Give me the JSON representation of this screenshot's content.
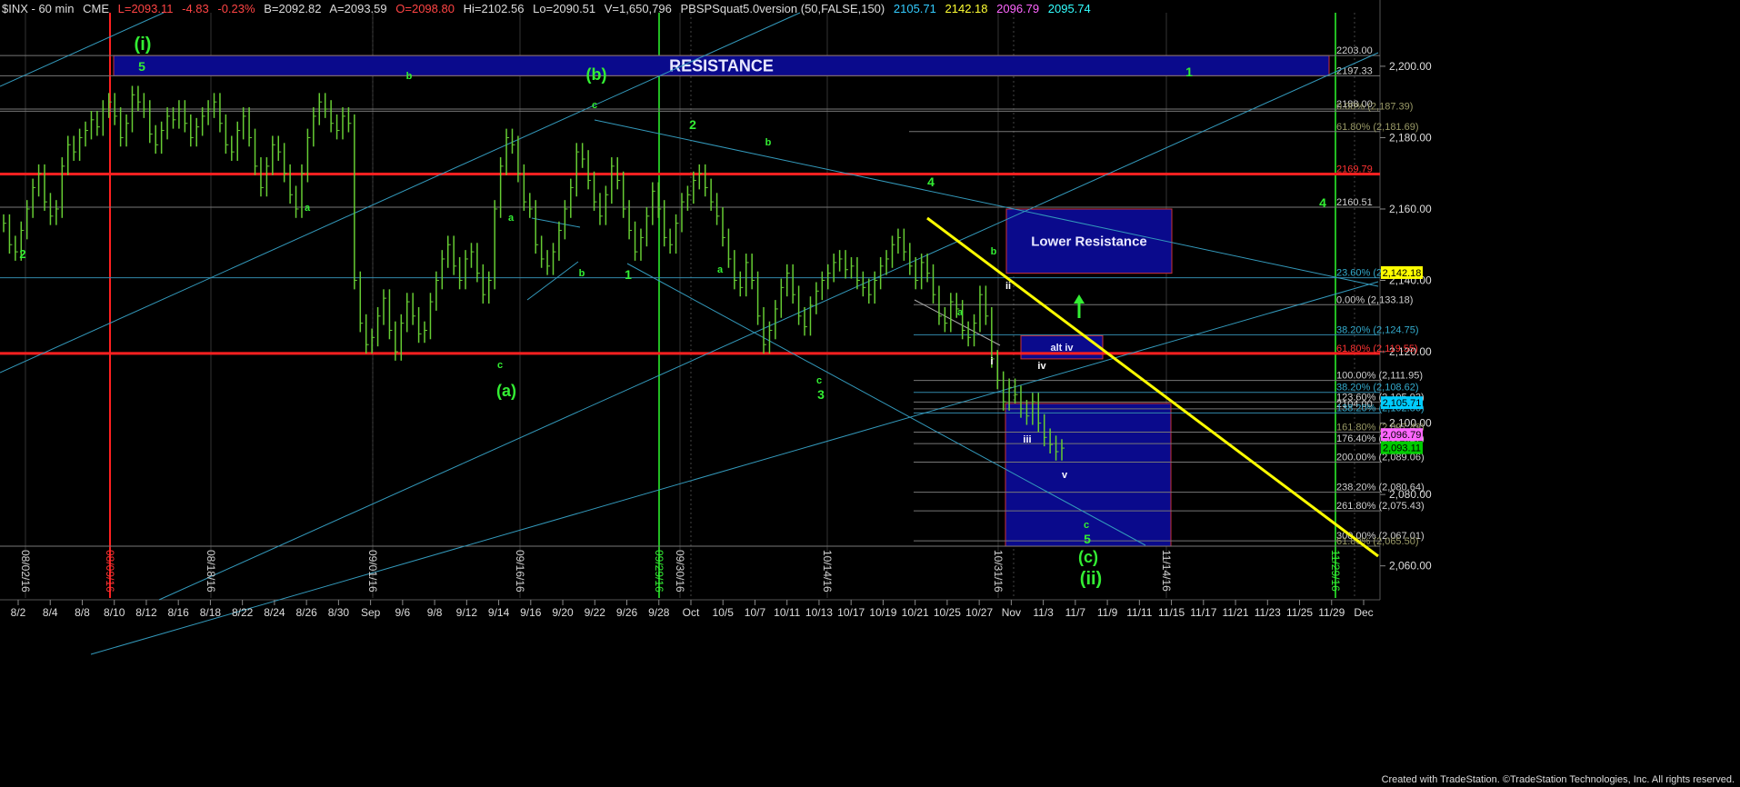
{
  "header": {
    "symbol": "$INX - 60 min",
    "exchange": "CME",
    "last": "L=2093.11",
    "change": "-4.83",
    "change_pct": "-0.23%",
    "bid": "B=2092.82",
    "ask": "A=2093.59",
    "open": "O=2098.80",
    "high": "Hi=2102.56",
    "low": "Lo=2090.51",
    "volume": "V=1,650,796",
    "study": "PBSPSquat5.0version (50,FALSE,150)",
    "study_values": [
      "2105.71",
      "2142.18",
      "2096.79",
      "2095.74"
    ],
    "study_colors": [
      "#33ccff",
      "#ffff33",
      "#ff66ff",
      "#33ffff"
    ]
  },
  "footer": "Created with TradeStation. ©TradeStation Technologies, Inc. All rights reserved.",
  "colors": {
    "background": "#000000",
    "bars": "#66cc33",
    "resistance_box": "#0a0a8c",
    "red_line": "#ff2020",
    "cyan_line": "#33aacc",
    "yellow_line": "#ffff00",
    "wave_label": "#33ee33",
    "fib_label": "#d0d0d0"
  },
  "chart_data": {
    "type": "line",
    "title": "",
    "xlabel": "",
    "ylabel": "",
    "ylim": [
      2051,
      2215
    ],
    "y_ticks": [
      "2,060.00",
      "2,080.00",
      "2,100.00",
      "2,120.00",
      "2,140.00",
      "2,160.00",
      "2,180.00",
      "2,200.00"
    ],
    "x_tick_labels": [
      "8/2",
      "8/4",
      "8/8",
      "8/10",
      "8/12",
      "8/16",
      "8/18",
      "8/22",
      "8/24",
      "8/26",
      "8/30",
      "Sep",
      "9/6",
      "9/8",
      "9/12",
      "9/14",
      "9/16",
      "9/20",
      "9/22",
      "9/26",
      "9/28",
      "Oct",
      "10/5",
      "10/7",
      "10/11",
      "10/13",
      "10/17",
      "10/19",
      "10/21",
      "10/25",
      "10/27",
      "Nov",
      "11/3",
      "11/7",
      "11/9",
      "11/11",
      "11/15",
      "11/17",
      "11/21",
      "11/23",
      "11/25",
      "11/29",
      "Dec"
    ],
    "vertical_date_labels": [
      {
        "text": "08/02/16",
        "color": "#d0d0d0"
      },
      {
        "text": "08/09/16",
        "color": "#ff3333"
      },
      {
        "text": "08/18/16",
        "color": "#d0d0d0"
      },
      {
        "text": "09/01/16",
        "color": "#d0d0d0"
      },
      {
        "text": "09/16/16",
        "color": "#d0d0d0"
      },
      {
        "text": "09/29/16",
        "color": "#33ee33"
      },
      {
        "text": "09/30/16",
        "color": "#d0d0d0"
      },
      {
        "text": "10/14/16",
        "color": "#d0d0d0"
      },
      {
        "text": "10/31/16",
        "color": "#d0d0d0"
      },
      {
        "text": "11/14/16",
        "color": "#d0d0d0"
      },
      {
        "text": "11/29/16",
        "color": "#33ee33"
      }
    ],
    "series": [
      {
        "values": [
          2156,
          2150,
          2148,
          2154,
          2160,
          2166,
          2170,
          2162,
          2158,
          2160,
          2172,
          2178,
          2176,
          2180,
          2182,
          2185,
          2183,
          2188,
          2190,
          2186,
          2180,
          2184,
          2192,
          2190,
          2188,
          2181,
          2178,
          2182,
          2186,
          2185,
          2188,
          2184,
          2180,
          2183,
          2186,
          2188,
          2190,
          2184,
          2178,
          2176,
          2182,
          2186,
          2180,
          2172,
          2166,
          2172,
          2178,
          2176,
          2170,
          2164,
          2160,
          2170,
          2180,
          2186,
          2190,
          2188,
          2184,
          2182,
          2186,
          2184,
          2140,
          2128,
          2122,
          2124,
          2130,
          2135,
          2126,
          2120,
          2128,
          2134,
          2130,
          2125,
          2126,
          2134,
          2140,
          2146,
          2150,
          2144,
          2140,
          2146,
          2148,
          2142,
          2136,
          2140,
          2160,
          2172,
          2180,
          2178,
          2170,
          2162,
          2160,
          2150,
          2146,
          2144,
          2148,
          2154,
          2160,
          2166,
          2176,
          2174,
          2168,
          2162,
          2158,
          2164,
          2172,
          2168,
          2160,
          2154,
          2148,
          2152,
          2158,
          2165,
          2160,
          2152,
          2150,
          2156,
          2162,
          2164,
          2168,
          2170,
          2166,
          2162,
          2158,
          2152,
          2146,
          2140,
          2138,
          2145,
          2140,
          2130,
          2122,
          2126,
          2132,
          2138,
          2142,
          2136,
          2130,
          2127,
          2133,
          2137,
          2140,
          2142,
          2145,
          2146,
          2143,
          2144,
          2140,
          2138,
          2136,
          2140,
          2144,
          2146,
          2150,
          2152,
          2148,
          2144,
          2140,
          2145,
          2142,
          2136,
          2130,
          2128,
          2134,
          2132,
          2126,
          2124,
          2128,
          2136,
          2130,
          2118,
          2112,
          2106,
          2110,
          2108,
          2104,
          2102,
          2106,
          2100,
          2096,
          2094,
          2092,
          2093
        ]
      }
    ],
    "horizontal_lines": [
      {
        "y": 2203.0,
        "label": "2203.00",
        "color": "#d0d0d0"
      },
      {
        "y": 2197.33,
        "label": "2197.33",
        "color": "#d0d0d0"
      },
      {
        "y": 2188.0,
        "label": "2188.00",
        "color": "#d0d0d0"
      },
      {
        "y": 2187.39,
        "label": "0.00% (2,187.39)",
        "color": "#999966"
      },
      {
        "y": 2181.69,
        "label": "61.80% (2,181.69)",
        "color": "#999966"
      },
      {
        "y": 2169.79,
        "label": "2169.79",
        "color": "#ff3333"
      },
      {
        "y": 2160.51,
        "label": "2160.51",
        "color": "#d0d0d0"
      },
      {
        "y": 2140.72,
        "label": "23.60% (2,140.72)",
        "color": "#33aacc"
      },
      {
        "y": 2133.18,
        "label": "0.00% (2,133.18)",
        "color": "#d0d0d0"
      },
      {
        "y": 2124.75,
        "label": "38.20% (2,124.75)",
        "color": "#33aacc"
      },
      {
        "y": 2119.55,
        "label": "61.80% (2,119.55)",
        "color": "#ff3333"
      },
      {
        "y": 2111.95,
        "label": "100.00% (2,111.95)",
        "color": "#d0d0d0"
      },
      {
        "y": 2108.62,
        "label": "38.20% (2,108.62)",
        "color": "#33aacc"
      },
      {
        "y": 2105.92,
        "label": "123.60% (2,105.92)",
        "color": "#d0d0d0"
      },
      {
        "y": 2104.0,
        "label": "2104.00",
        "color": "#d0d0d0"
      },
      {
        "y": 2102.86,
        "label": "138.20% (2,102.86)",
        "color": "#33aacc"
      },
      {
        "y": 2097.49,
        "label": "161.80% (2,097.49)",
        "color": "#999966"
      },
      {
        "y": 2094.27,
        "label": "176.40% (2,094.27)",
        "color": "#d0d0d0"
      },
      {
        "y": 2089.06,
        "label": "200.00% (2,089.06)",
        "color": "#d0d0d0"
      },
      {
        "y": 2080.64,
        "label": "238.20% (2,080.64)",
        "color": "#d0d0d0"
      },
      {
        "y": 2075.43,
        "label": "261.80% (2,075.43)",
        "color": "#d0d0d0"
      },
      {
        "y": 2067.01,
        "label": "300.00% (2,067.01)",
        "color": "#d0d0d0"
      },
      {
        "y": 2065.5,
        "label": "61.80% (2,065.50)",
        "color": "#999966"
      }
    ],
    "price_badges": [
      {
        "y": 2142.18,
        "label": "2,142.18",
        "bg": "#ffff00",
        "fg": "#000000"
      },
      {
        "y": 2105.71,
        "label": "2,105.71",
        "bg": "#00ccff",
        "fg": "#000000"
      },
      {
        "y": 2096.79,
        "label": "2,096.79",
        "bg": "#ff66ff",
        "fg": "#000000"
      },
      {
        "y": 2093.11,
        "label": "2,093.11",
        "bg": "#00cc00",
        "fg": "#000000"
      }
    ],
    "boxes": [
      {
        "label": "RESISTANCE",
        "y_top": 2203.0,
        "y_bottom": 2197.33
      },
      {
        "label": "Lower Resistance",
        "y_top": 2160.0,
        "y_bottom": 2142.0
      },
      {
        "label": "alt iv",
        "y_top": 2124.5,
        "y_bottom": 2118.0
      },
      {
        "label": "",
        "y_top": 2105.5,
        "y_bottom": 2065.5
      }
    ],
    "wave_labels": [
      {
        "text": "(i)",
        "color": "#33ee33"
      },
      {
        "text": "5",
        "color": "#33ee33"
      },
      {
        "text": "(b)",
        "color": "#33ee33"
      },
      {
        "text": "1",
        "color": "#33ee33"
      },
      {
        "text": "2",
        "color": "#33ee33"
      },
      {
        "text": "4",
        "color": "#33ee33"
      },
      {
        "text": "2",
        "color": "#33ee33"
      },
      {
        "text": "4",
        "color": "#33ee33"
      },
      {
        "text": "a",
        "color": "#33ee33"
      },
      {
        "text": "b",
        "color": "#33ee33"
      },
      {
        "text": "c",
        "color": "#33ee33"
      },
      {
        "text": "a",
        "color": "#33ee33"
      },
      {
        "text": "b",
        "color": "#33ee33"
      },
      {
        "text": "c",
        "color": "#33ee33"
      },
      {
        "text": "(a)",
        "color": "#33ee33"
      },
      {
        "text": "1",
        "color": "#33ee33"
      },
      {
        "text": "b",
        "color": "#33ee33"
      },
      {
        "text": "a",
        "color": "#33ee33"
      },
      {
        "text": "c",
        "color": "#33ee33"
      },
      {
        "text": "3",
        "color": "#33ee33"
      },
      {
        "text": "b",
        "color": "#33ee33"
      },
      {
        "text": "a",
        "color": "#33ee33"
      },
      {
        "text": "ii",
        "color": "#ffffff"
      },
      {
        "text": "i",
        "color": "#ffffff"
      },
      {
        "text": "iv",
        "color": "#ffffff"
      },
      {
        "text": "iii",
        "color": "#ffffff"
      },
      {
        "text": "v",
        "color": "#ffffff"
      },
      {
        "text": "c",
        "color": "#33ee33"
      },
      {
        "text": "5",
        "color": "#33ee33"
      },
      {
        "text": "(c)",
        "color": "#33ee33"
      },
      {
        "text": "(ii)",
        "color": "#33ee33"
      }
    ]
  }
}
